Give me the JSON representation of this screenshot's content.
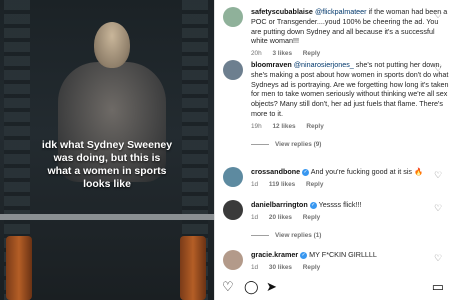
{
  "video": {
    "caption": "idk what Sydney Sweeney\nwas doing, but this is\nwhat a women in sports\nlooks like"
  },
  "comments": [
    {
      "user": "safetyscubablaise",
      "mention": "@flickpalmateer",
      "text": " if the woman had been a POC or Transgender....youd 100% be cheering the ad. You are putting down Sydney and all because it's a successful white woman!!!",
      "time": "20h",
      "likes": "3 likes",
      "reply": "Reply",
      "avatar_color": "#8fb19a"
    },
    {
      "user": "bloomraven",
      "mention": "@ninarosierjones_",
      "text": " she's not putting her down, she's making a post about how women in sports don't do what Sydneys ad is portraying. Are we forgetting how long it's taken for men to take women seriously without thinking we're all sex objects? Many still don't, her ad just fuels that flame. There's more to it.",
      "time": "19h",
      "likes": "12 likes",
      "reply": "Reply",
      "avatar_color": "#6d7f8f"
    },
    {
      "user": "crossandbone",
      "text": "And you're fucking good at it sis 🔥",
      "time": "1d",
      "likes": "119 likes",
      "reply": "Reply",
      "verified": true,
      "avatar_color": "#5d8aa0"
    },
    {
      "user": "danielbarrington",
      "text": "Yessss flick!!!",
      "time": "1d",
      "likes": "20 likes",
      "reply": "Reply",
      "verified": true,
      "avatar_color": "#3a3a3a"
    },
    {
      "user": "gracie.kramer",
      "text": "MY F*CKIN GIRLLLL",
      "time": "1d",
      "likes": "30 likes",
      "reply": "Reply",
      "verified": true,
      "avatar_color": "#b39a8a"
    }
  ],
  "view_replies": [
    "View replies (9)",
    "View replies (1)"
  ],
  "actions": {
    "heart": "heart-icon",
    "comment": "comment-icon",
    "share": "share-icon",
    "save": "bookmark-icon"
  },
  "colors": {
    "mention": "#00376b",
    "meta": "#737373",
    "verified": "#3897f0"
  }
}
